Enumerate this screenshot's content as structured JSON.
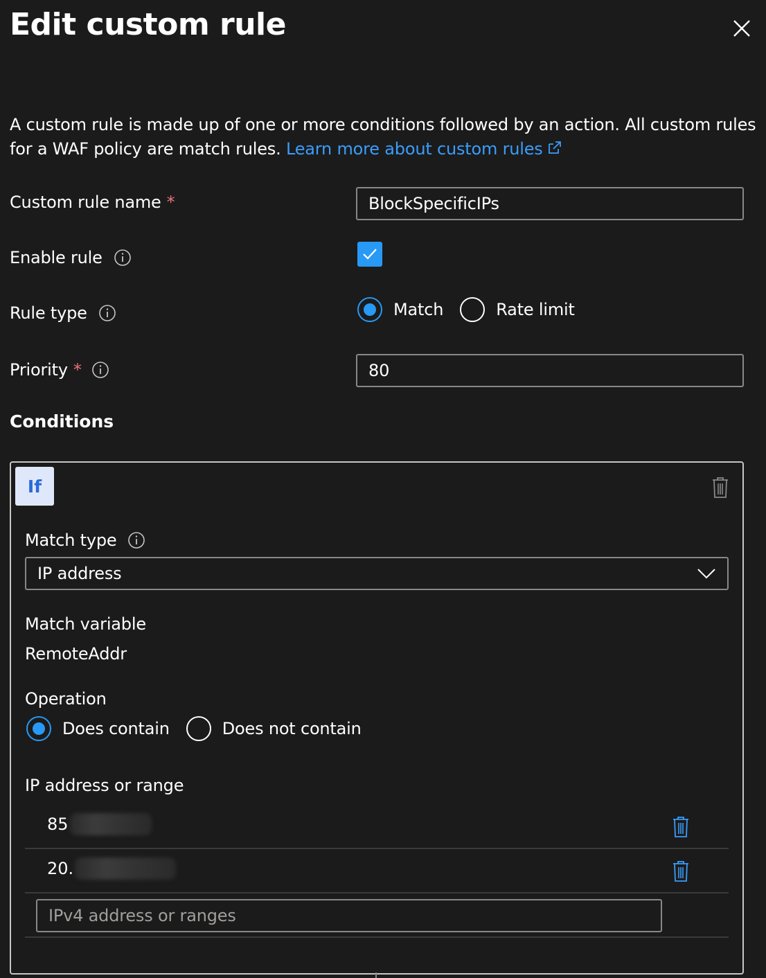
{
  "panel": {
    "title": "Edit custom rule"
  },
  "description": {
    "text": "A custom rule is made up of one or more conditions followed by an action. All custom rules for a WAF policy are match rules.",
    "link_text": "Learn more about custom rules"
  },
  "fields": {
    "name_label": "Custom rule name",
    "name_value": "BlockSpecificIPs",
    "required_mark": "*",
    "enable_label": "Enable rule",
    "enable_checked": true,
    "rule_type_label": "Rule type",
    "rule_type_options": [
      "Match",
      "Rate limit"
    ],
    "rule_type_selected": "Match",
    "priority_label": "Priority",
    "priority_value": "80"
  },
  "conditions": {
    "section_title": "Conditions",
    "if_label": "If",
    "match_type_label": "Match type",
    "match_type_value": "IP address",
    "match_variable_label": "Match variable",
    "match_variable_value": "RemoteAddr",
    "operation_label": "Operation",
    "operation_options": [
      "Does contain",
      "Does not contain"
    ],
    "operation_selected": "Does contain",
    "ip_label": "IP address or range",
    "ip_entries": [
      "85",
      "20."
    ],
    "ip_placeholder": "IPv4 address or ranges"
  },
  "colors": {
    "background": "#1b1b1b",
    "accent": "#2899f5",
    "link": "#3a9dfc",
    "required": "#f1707b",
    "border": "#8a8886"
  }
}
